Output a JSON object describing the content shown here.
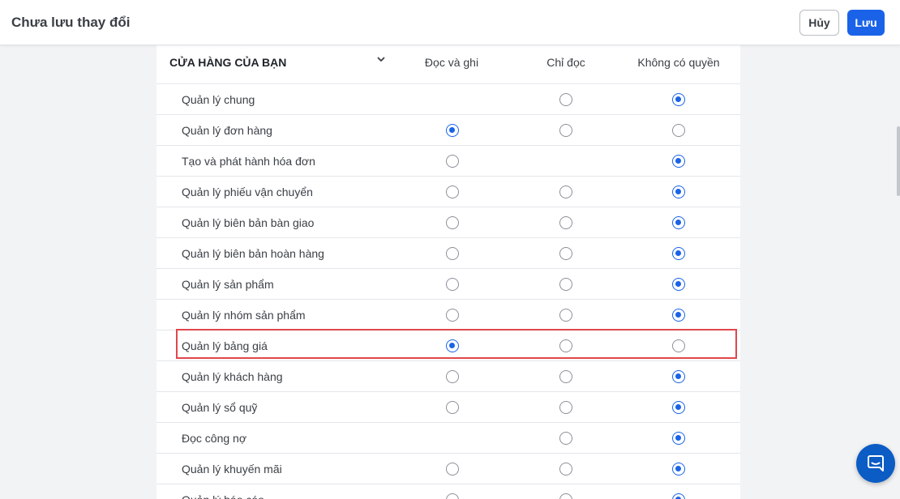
{
  "header": {
    "title": "Chưa lưu thay đổi",
    "cancel_label": "Hủy",
    "save_label": "Lưu"
  },
  "section": {
    "title": "CỬA HÀNG CỦA BẠN",
    "columns": [
      "Đọc và ghi",
      "Chỉ đọc",
      "Không có quyền"
    ]
  },
  "permissions": [
    {
      "label": "Quản lý chung",
      "options": [
        "none",
        "unchecked",
        "checked"
      ]
    },
    {
      "label": "Quản lý đơn hàng",
      "options": [
        "checked",
        "unchecked",
        "unchecked"
      ]
    },
    {
      "label": "Tạo và phát hành hóa đơn",
      "options": [
        "unchecked",
        "none",
        "checked"
      ]
    },
    {
      "label": "Quản lý phiếu vận chuyển",
      "options": [
        "unchecked",
        "unchecked",
        "checked"
      ]
    },
    {
      "label": "Quản lý biên bản bàn giao",
      "options": [
        "unchecked",
        "unchecked",
        "checked"
      ]
    },
    {
      "label": "Quản lý biên bản hoàn hàng",
      "options": [
        "unchecked",
        "unchecked",
        "checked"
      ]
    },
    {
      "label": "Quản lý sản phẩm",
      "options": [
        "unchecked",
        "unchecked",
        "checked"
      ]
    },
    {
      "label": "Quản lý nhóm sản phẩm",
      "options": [
        "unchecked",
        "unchecked",
        "checked"
      ]
    },
    {
      "label": "Quản lý bảng giá",
      "options": [
        "checked",
        "unchecked",
        "unchecked"
      ],
      "highlighted": true
    },
    {
      "label": "Quản lý khách hàng",
      "options": [
        "unchecked",
        "unchecked",
        "checked"
      ]
    },
    {
      "label": "Quản lý sổ quỹ",
      "options": [
        "unchecked",
        "unchecked",
        "checked"
      ]
    },
    {
      "label": "Đọc công nợ",
      "options": [
        "none",
        "unchecked",
        "checked"
      ]
    },
    {
      "label": "Quản lý khuyến mãi",
      "options": [
        "unchecked",
        "unchecked",
        "checked"
      ]
    },
    {
      "label": "Quản lý báo cáo",
      "options": [
        "unchecked",
        "unchecked",
        "checked"
      ]
    }
  ],
  "colors": {
    "accent": "#1a63e8",
    "highlight_border": "#e0474c",
    "chat_button": "#0b5cc4"
  },
  "icons": {
    "dropdown": "chevron-down-icon",
    "chat": "chat-bubble-icon"
  }
}
